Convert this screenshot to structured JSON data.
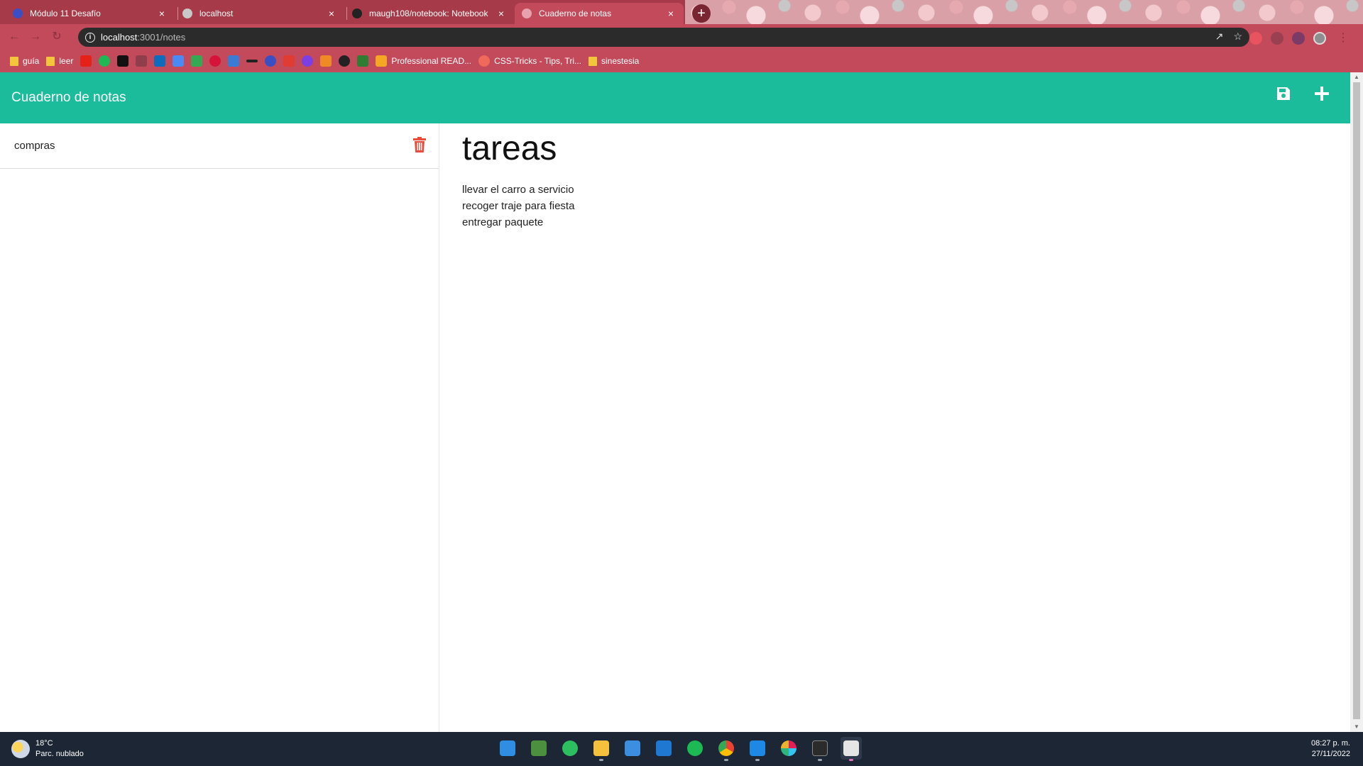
{
  "browser": {
    "tabs": [
      {
        "label": "Módulo 11 Desafío",
        "active": false,
        "favicon_color": "#3b4fc4"
      },
      {
        "label": "localhost",
        "active": false,
        "favicon_color": "#c8c8c8"
      },
      {
        "label": "maugh108/notebook: Notebook",
        "active": false,
        "favicon_color": "#222222"
      },
      {
        "label": "Cuaderno de notas",
        "active": true,
        "favicon_color": "#e6a3ad"
      }
    ],
    "close_glyph": "×",
    "new_tab_glyph": "+",
    "url_host": "localhost",
    "url_path": ":3001/notes",
    "bookmarks": [
      {
        "label": "guía",
        "type": "folder"
      },
      {
        "label": "leer",
        "type": "folder"
      },
      {
        "label": "Professional READ...",
        "type": "link"
      },
      {
        "label": "CSS-Tricks - Tips, Tri...",
        "type": "link"
      },
      {
        "label": "sinestesia",
        "type": "folder"
      }
    ]
  },
  "app": {
    "title": "Cuaderno de notas",
    "accent_color": "#1abc9c",
    "notes": [
      {
        "title": "compras"
      }
    ],
    "active_note": {
      "title": "tareas",
      "lines": [
        "llevar el carro a servicio",
        "recoger traje para fiesta",
        "entregar paquete"
      ]
    }
  },
  "taskbar": {
    "temperature": "18°C",
    "weather": "Parc. nublado",
    "time": "08:27 p. m.",
    "date": "27/11/2022"
  }
}
